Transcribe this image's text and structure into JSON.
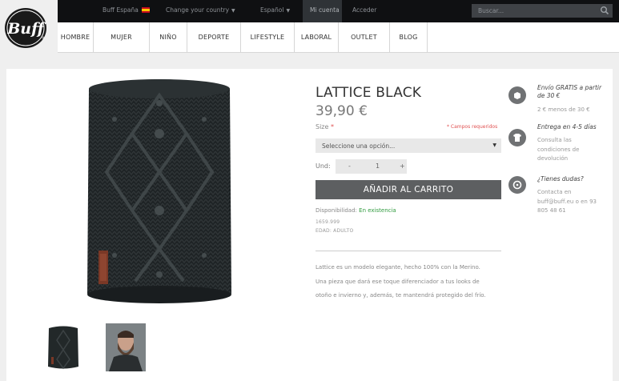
{
  "topbar": {
    "store": "Buff España",
    "change_country": "Change your country",
    "language": "Español",
    "my_account": "Mi cuenta",
    "login": "Acceder",
    "search_placeholder": "Buscar..."
  },
  "brand": {
    "logo_text": "Buff"
  },
  "nav": [
    "HOMBRE",
    "MUJER",
    "NIÑO",
    "DEPORTE",
    "LIFESTYLE",
    "LABORAL",
    "OUTLET",
    "BLOG"
  ],
  "product": {
    "title": "LATTICE BLACK",
    "price": "39,90 €",
    "size_label": "Size",
    "size_required_mark": "*",
    "required_note": "* Campos requeridos",
    "size_select_value": "Seleccione una opción...",
    "qty_label": "Und:",
    "qty_minus": "-",
    "qty_value": "1",
    "qty_plus": "+",
    "add_to_cart": "AÑADIR AL CARRITO",
    "availability_label": "Disponibilidad:",
    "availability_value": "En existencia",
    "sku": "1659.999",
    "age": "EDAD: ADULTO",
    "description_lines": [
      "Lattice es un modelo elegante, hecho 100% con la Merino.",
      "Una pieza que dará ese toque diferenciador a tus looks de",
      "otoño e invierno y, además, te mantendrá protegido del frío."
    ]
  },
  "sidebar": {
    "shipping_title_1": "Envío GRATIS a partir",
    "shipping_title_2": "de 30 €",
    "shipping_sub": "2 € menos de 30 €",
    "delivery_title": "Entrega en 4-5 días",
    "delivery_sub_1": "Consulta las",
    "delivery_sub_2": "condiciones de",
    "delivery_sub_3": "devolución",
    "questions_title": "¿Tienes dudas?",
    "questions_sub_1": "Contacta en",
    "questions_sub_2": "buff@buff.eu o en 93",
    "questions_sub_3": "805 48 61"
  },
  "colors": {
    "topbar_bg": "#0f1012",
    "cart_button": "#5d5f61",
    "in_stock": "#2f9a3e",
    "required": "#e05050"
  }
}
